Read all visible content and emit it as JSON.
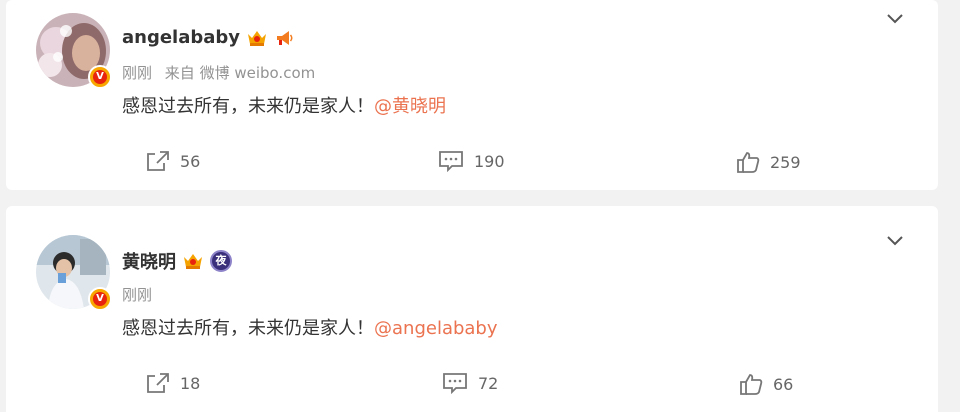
{
  "posts": [
    {
      "author": "angelababy",
      "time": "刚刚",
      "source": "来自 微博 weibo.com",
      "text": "感恩过去所有，未来仍是家人！",
      "mention": "@黄晓明",
      "reposts": "56",
      "comments": "190",
      "likes": "259",
      "verified_badge": "V",
      "icons": [
        "crown-icon",
        "megaphone-icon"
      ]
    },
    {
      "author": "黄晓明",
      "time": "刚刚",
      "source": "",
      "text": "感恩过去所有，未来仍是家人！",
      "mention": "@angelababy",
      "reposts": "18",
      "comments": "72",
      "likes": "66",
      "verified_badge": "V",
      "night_badge": "夜",
      "icons": [
        "crown-icon",
        "night-badge-icon"
      ]
    }
  ],
  "colors": {
    "background": "#f2f2f2",
    "card": "#ffffff",
    "mention": "#eb7350",
    "meta": "#939393",
    "verified_outer": "#f7a700",
    "verified_inner": "#e8230e"
  }
}
